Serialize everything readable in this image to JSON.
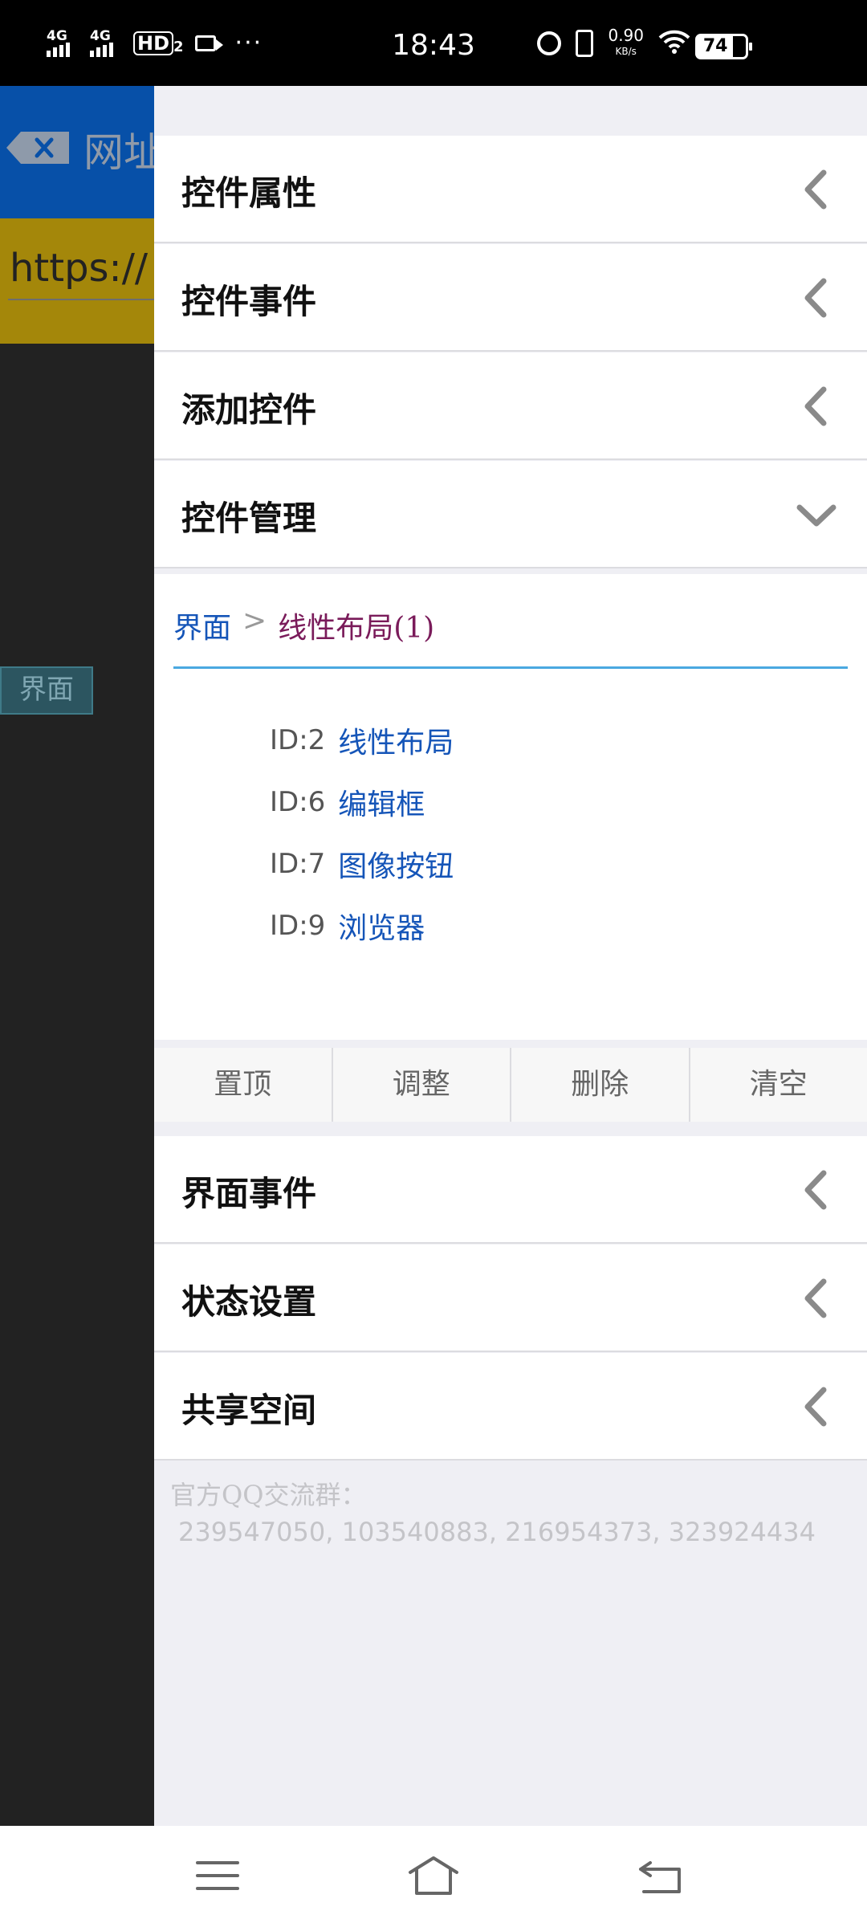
{
  "status_bar": {
    "network1": "4G",
    "network2": "4G",
    "hd_label": "HD",
    "hd_sub": "2",
    "more": "···",
    "time": "18:43",
    "speed_value": "0.90",
    "speed_unit": "KB/s",
    "battery_level": "74"
  },
  "background_app": {
    "title_partial": "网址",
    "url_partial": "https://",
    "tag_label": "界面"
  },
  "drawer": {
    "sections_top": [
      {
        "label": "控件属性"
      },
      {
        "label": "控件事件"
      },
      {
        "label": "添加控件"
      },
      {
        "label": "控件管理"
      }
    ],
    "breadcrumb": {
      "root": "界面",
      "separator": ">",
      "current": "线性布局(1)"
    },
    "controls": [
      {
        "id": "ID:2",
        "name": "线性布局"
      },
      {
        "id": "ID:6",
        "name": "编辑框"
      },
      {
        "id": "ID:7",
        "name": "图像按钮"
      },
      {
        "id": "ID:9",
        "name": "浏览器"
      }
    ],
    "actions": {
      "pin_top": "置顶",
      "adjust": "调整",
      "delete": "删除",
      "clear": "清空"
    },
    "sections_bottom": [
      {
        "label": "界面事件"
      },
      {
        "label": "状态设置"
      },
      {
        "label": "共享空间"
      }
    ],
    "footer": {
      "line1": "官方QQ交流群：",
      "line2": "239547050, 103540883, 216954373, 323924434"
    }
  },
  "colors": {
    "accent_blue": "#1555b8",
    "breadcrumb_current": "#7a1b5a",
    "divider_line": "#4aa8e0"
  }
}
